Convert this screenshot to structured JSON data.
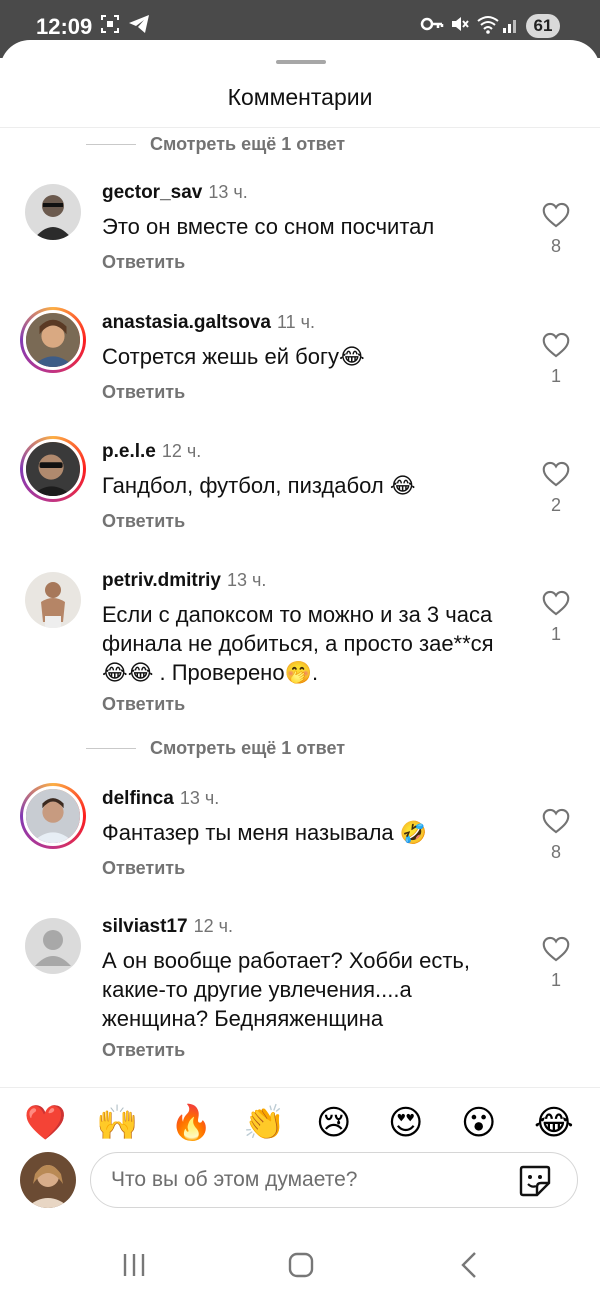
{
  "status_bar": {
    "time": "12:09",
    "battery": "61",
    "icons": [
      "screenshot-icon",
      "telegram-icon",
      "key-icon",
      "mute-icon",
      "wifi-icon",
      "signal-icon"
    ]
  },
  "sheet": {
    "title": "Комментарии"
  },
  "view_more_top": "Смотреть ещё 1 ответ",
  "view_more_mid": "Смотреть ещё 1 ответ",
  "comments": [
    {
      "user": "gector_sav",
      "time": "13 ч.",
      "text": "Это он вместе со сном посчитал",
      "reply": "Ответить",
      "likes": "8"
    },
    {
      "user": "anastasia.galtsova",
      "time": "11 ч.",
      "text": "Сотрется жешь ей богу😂",
      "reply": "Ответить",
      "likes": "1"
    },
    {
      "user": "p.e.l.e",
      "time": "12 ч.",
      "text": "Гандбол, футбол, пиздабол 😂",
      "reply": "Ответить",
      "likes": "2"
    },
    {
      "user": "petriv.dmitriy",
      "time": "13 ч.",
      "text": "Если с дапоксом то можно и за 3 часа финала не добиться, а просто зае**ся😂😂 . Проверено🤭.",
      "reply": "Ответить",
      "likes": "1"
    },
    {
      "user": "delfinca",
      "time": "13 ч.",
      "text": "Фантазер ты меня называла 🤣",
      "reply": "Ответить",
      "likes": "8"
    },
    {
      "user": "silviast17",
      "time": "12 ч.",
      "text": "А он вообще работает? Хобби есть, какие-то другие увлечения....а женщина? Бедняяженщина",
      "reply": "Ответить",
      "likes": "1"
    }
  ],
  "quick_emojis": [
    "❤️",
    "🙌",
    "🔥",
    "👏",
    "😢",
    "😍",
    "😮",
    "😂"
  ],
  "composer": {
    "placeholder": "Что вы об этом думаете?"
  },
  "colors": {
    "secondary_text": "#737373",
    "status_bg": "#4a4a4a",
    "heart": "#e0245e"
  }
}
